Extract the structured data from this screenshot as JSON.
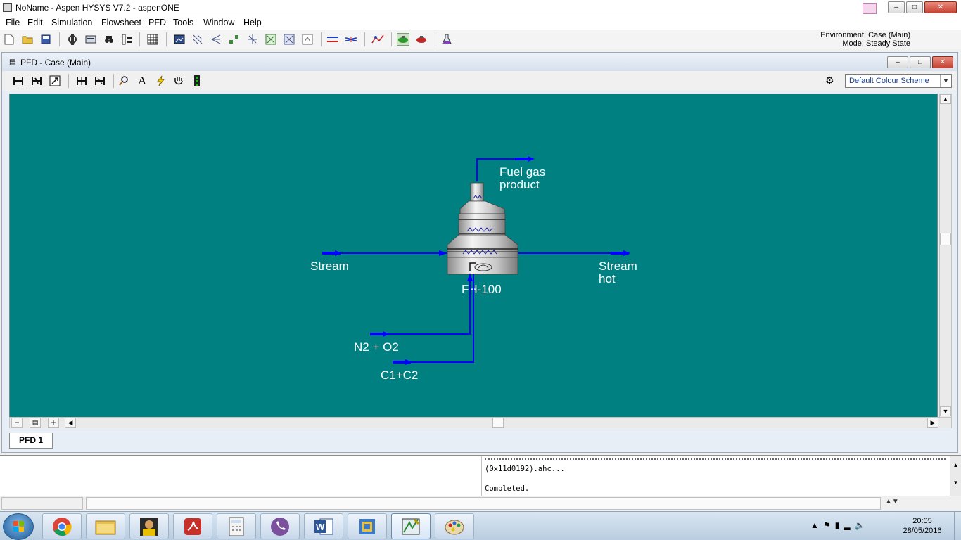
{
  "window": {
    "title": "NoName - Aspen HYSYS V7.2 - aspenONE",
    "minimize": "–",
    "maximize": "□",
    "close": "✕"
  },
  "menu": [
    "File",
    "Edit",
    "Simulation",
    "Flowsheet",
    "PFD",
    "Tools",
    "Window",
    "Help"
  ],
  "toolbar_icons": [
    "new-icon",
    "open-icon",
    "save-icon",
    "component-icon",
    "fluid-package-icon",
    "binoculars-icon",
    "workbook-icon",
    "spreadsheet-icon",
    "snapshot-icon",
    "calculator-icon",
    "tree-icon",
    "grid-icon",
    "table-icon",
    "object-icon",
    "stream-icon",
    "material-stream-icon",
    "energy-stream-icon",
    "flow-icon",
    "solver-active-icon",
    "solver-hold-icon",
    "flask-icon"
  ],
  "environment": {
    "line1": "Environment: Case (Main)",
    "line2": "Mode: Steady State"
  },
  "pfd": {
    "window_title": "PFD - Case (Main)",
    "colour_scheme": "Default Colour Scheme",
    "tab": "PFD 1",
    "streams": {
      "feed": "Stream",
      "fuel_gas_1": "Fuel gas",
      "fuel_gas_2": "product",
      "hot_1": "Stream",
      "hot_2": "hot",
      "air": "N2 + O2",
      "fuel": "C1+C2"
    },
    "unit_label": "FH-100"
  },
  "log": {
    "line1": "(0x11d0192).ahc...",
    "line2": "Completed."
  },
  "taskbar": {
    "time": "20:05",
    "date": "28/05/2016"
  },
  "colors": {
    "canvas": "#008080",
    "stream_line": "#0000ff"
  }
}
